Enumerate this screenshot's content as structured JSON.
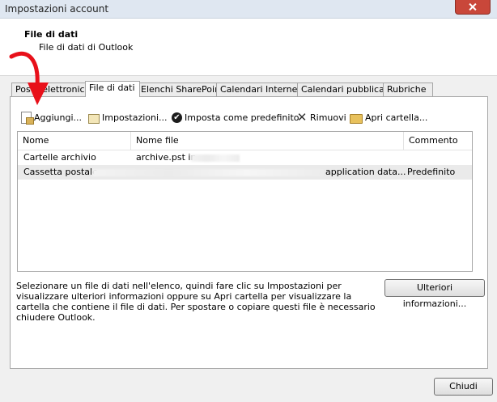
{
  "window": {
    "title": "Impostazioni account"
  },
  "header": {
    "title": "File di dati",
    "subtitle": "File di dati di Outlook"
  },
  "tabs": [
    {
      "label": "Posta elettronica"
    },
    {
      "label": "File di dati"
    },
    {
      "label": "Elenchi SharePoint"
    },
    {
      "label": "Calendari Internet"
    },
    {
      "label": "Calendari pubblicati"
    },
    {
      "label": "Rubriche"
    }
  ],
  "toolbar": {
    "add": "Aggiungi...",
    "settings": "Impostazioni...",
    "default": "Imposta come predefinito",
    "remove": "Rimuovi",
    "open": "Apri cartella..."
  },
  "table": {
    "columns": [
      "Nome",
      "Nome file",
      "Commento"
    ],
    "rows": [
      {
        "name": "Cartelle archivio",
        "file": "archive.pst in",
        "comment": ""
      },
      {
        "name": "Cassetta postale",
        "file": "application data...",
        "comment": "Predefinito"
      }
    ]
  },
  "info_text": "Selezionare un file di dati nell'elenco, quindi fare clic su Impostazioni per visualizzare ulteriori informazioni oppure su Apri cartella per visualizzare la cartella che contiene il file di dati. Per spostare o copiare questi file è necessario chiudere Outlook.",
  "more_info_button": "Ulteriori informazioni...",
  "close_button": "Chiudi",
  "colors": {
    "arrow": "#e8101a",
    "close_button": "#c9473a"
  }
}
